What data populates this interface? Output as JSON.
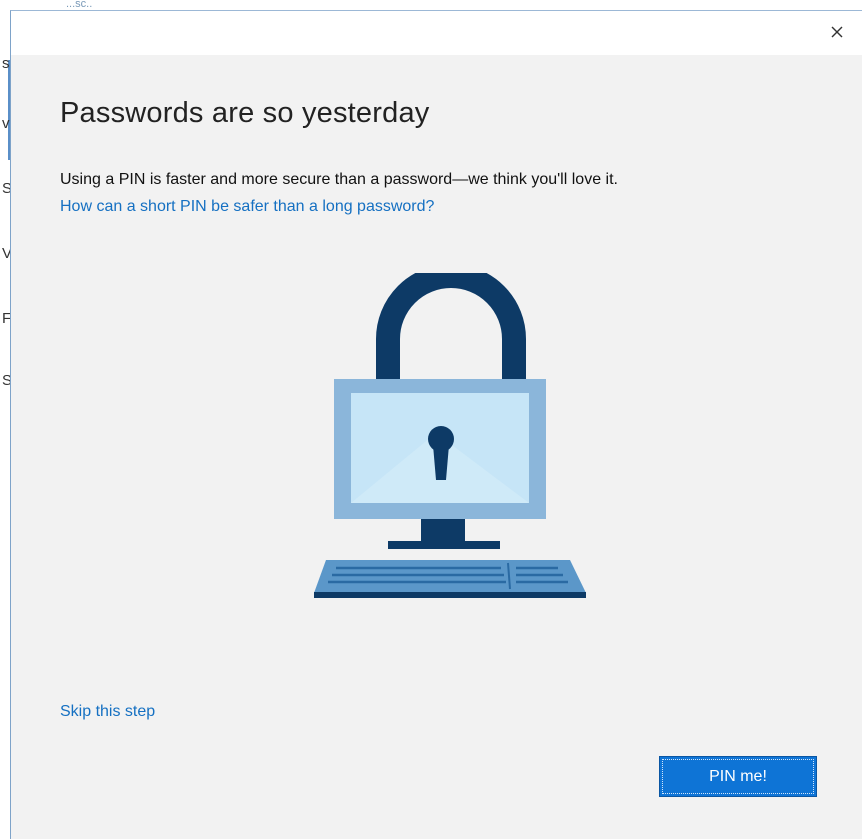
{
  "background_window": {
    "fragment_letters": [
      "s",
      "v",
      "S",
      "V",
      "F",
      "S"
    ],
    "top_fragment": "...sc.."
  },
  "dialog": {
    "close_label": "×",
    "heading": "Passwords are so yesterday",
    "description": "Using a PIN is faster and more secure than a password—we think you'll love it.",
    "help_link": "How can a short PIN be safer than a long password?",
    "illustration_icon": "lock-computer-icon",
    "skip_link": "Skip this step",
    "pin_button": "PIN me!"
  },
  "colors": {
    "dialog_bg": "#f2f2f2",
    "link": "#1570c2",
    "button_bg": "#0e74d6",
    "lock_dark": "#0d3a66",
    "screen_frame": "#8bb6da",
    "screen_fill": "#c6e5f7"
  }
}
